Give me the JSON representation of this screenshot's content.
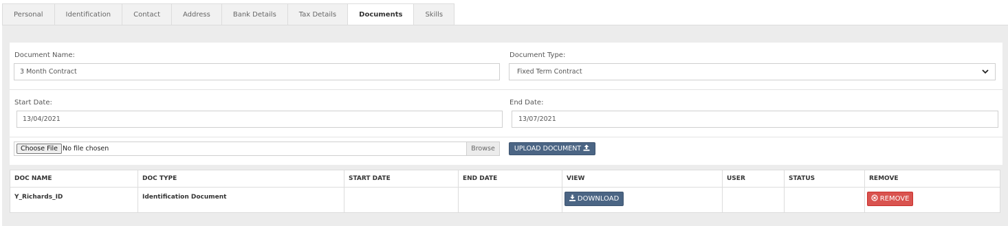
{
  "tabs": [
    {
      "label": "Personal",
      "active": false
    },
    {
      "label": "Identification",
      "active": false
    },
    {
      "label": "Contact",
      "active": false
    },
    {
      "label": "Address",
      "active": false
    },
    {
      "label": "Bank Details",
      "active": false
    },
    {
      "label": "Tax Details",
      "active": false
    },
    {
      "label": "Documents",
      "active": true
    },
    {
      "label": "Skills",
      "active": false
    }
  ],
  "form": {
    "doc_name_label": "Document Name:",
    "doc_name_value": "3 Month Contract",
    "doc_type_label": "Document Type:",
    "doc_type_value": "Fixed Term Contract",
    "start_date_label": "Start Date:",
    "start_date_value": "13/04/2021",
    "end_date_label": "End Date:",
    "end_date_value": "13/07/2021",
    "choose_file_label": "Choose File",
    "no_file_text": "No file chosen",
    "browse_label": "Browse",
    "upload_label": "UPLOAD DOCUMENT"
  },
  "table": {
    "headers": [
      "DOC NAME",
      "DOC TYPE",
      "START DATE",
      "END DATE",
      "VIEW",
      "USER",
      "STATUS",
      "REMOVE"
    ],
    "rows": [
      {
        "doc_name": "Y_Richards_ID",
        "doc_type": "Identification Document",
        "start_date": "",
        "end_date": "",
        "view_label": "DOWNLOAD",
        "user": "",
        "status": "",
        "remove_label": "REMOVE"
      }
    ]
  },
  "colors": {
    "primary_button": "#4b6584",
    "danger_button": "#d9534f",
    "panel_bg": "#ececec"
  },
  "icons": {
    "upload": "upload-icon",
    "download": "download-icon",
    "remove": "remove-circle-icon",
    "select": "chevron-down-icon"
  }
}
